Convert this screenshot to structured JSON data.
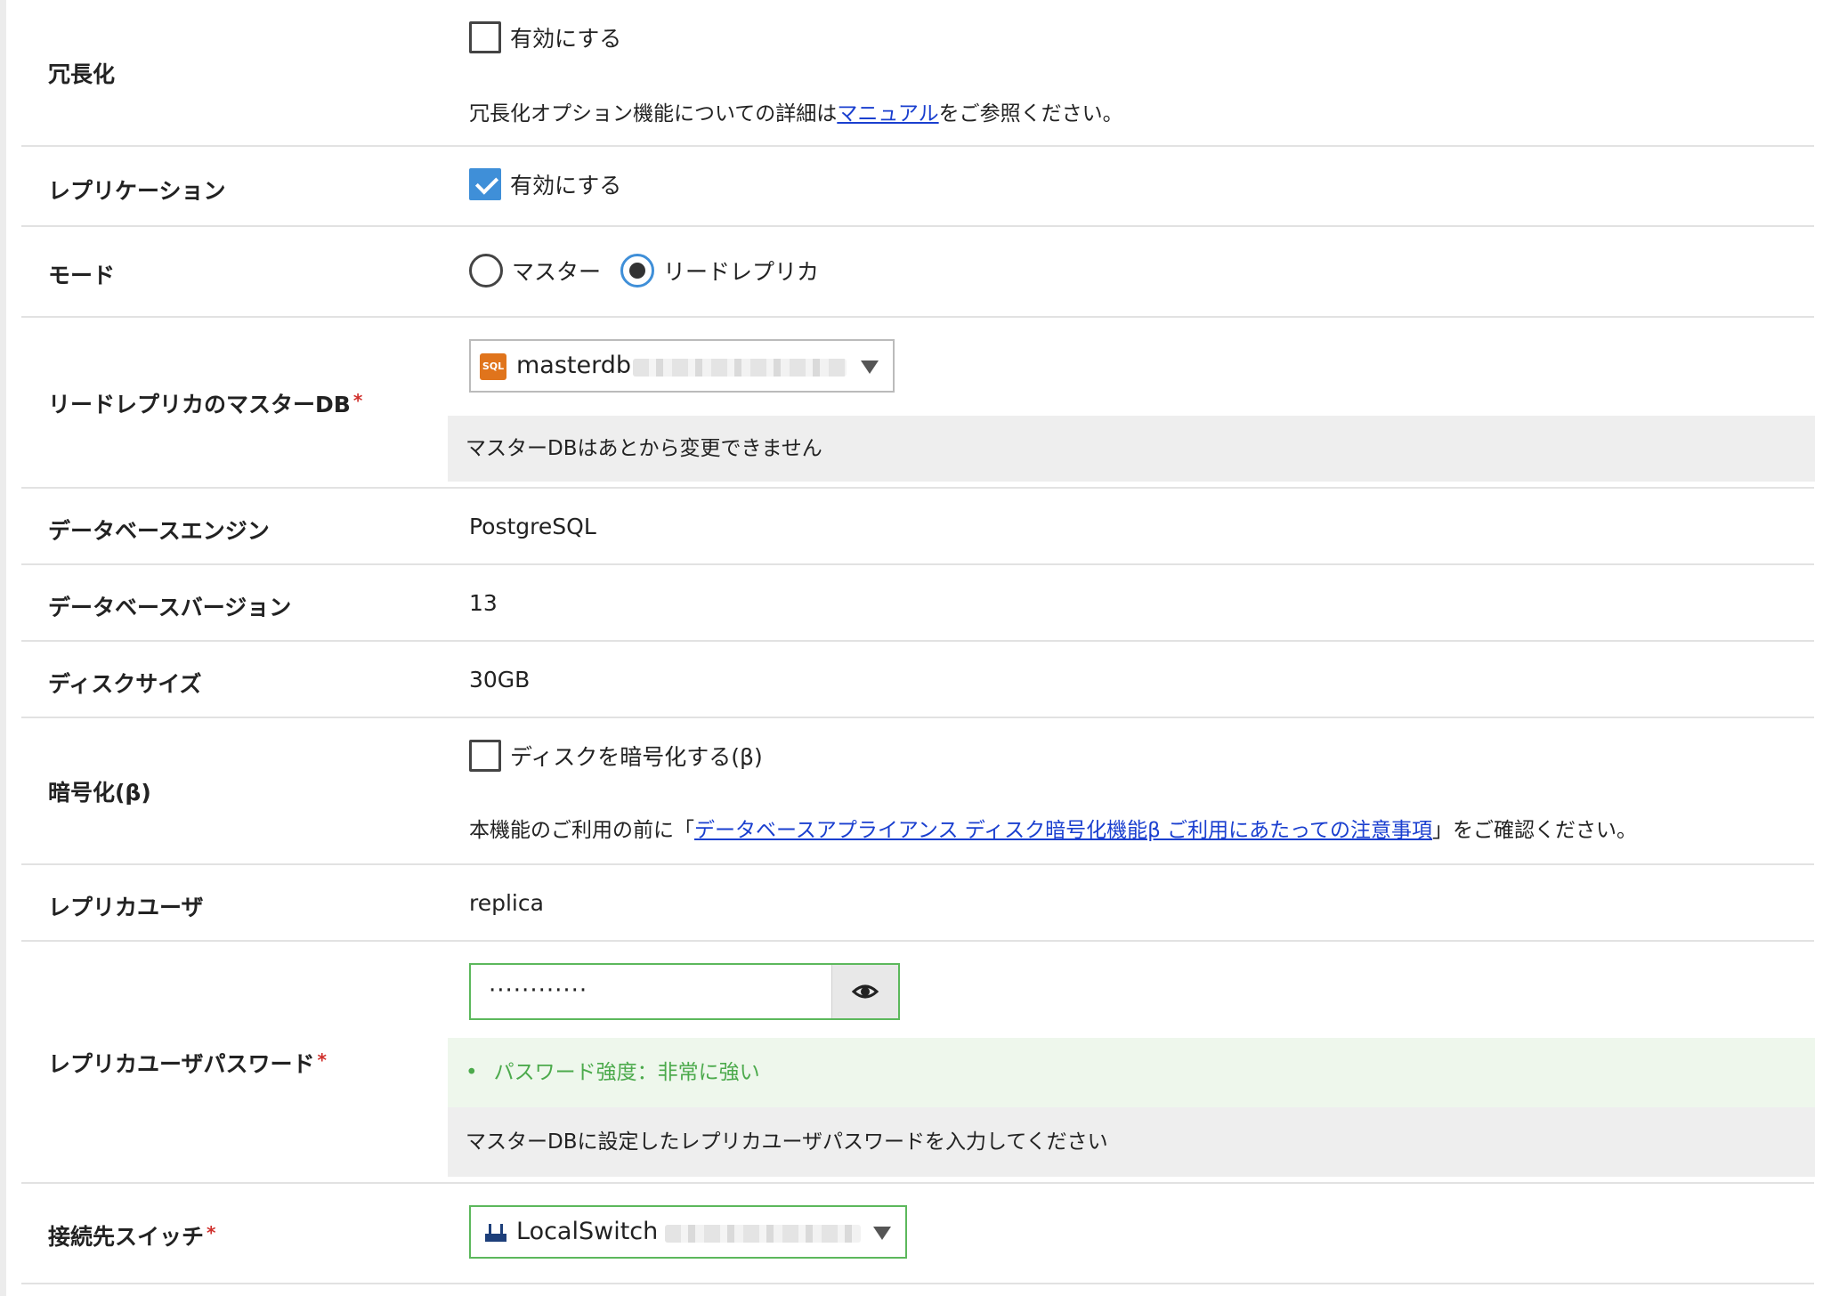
{
  "form": {
    "redundancy": {
      "label": "冗長化",
      "checkbox_label": "有効にする",
      "checked": false,
      "note_prefix": "冗長化オプション機能についての詳細は",
      "note_link": "マニュアル",
      "note_suffix": "をご参照ください。"
    },
    "replication": {
      "label": "レプリケーション",
      "checkbox_label": "有効にする",
      "checked": true
    },
    "mode": {
      "label": "モード",
      "options": [
        "マスター",
        "リードレプリカ"
      ],
      "selected": "リードレプリカ"
    },
    "master_db": {
      "label": "リードレプリカのマスターDB",
      "required_mark": "*",
      "icon_text": "SQL",
      "selected": "masterdb",
      "help": "マスターDBはあとから変更できません"
    },
    "engine": {
      "label": "データベースエンジン",
      "value": "PostgreSQL"
    },
    "version": {
      "label": "データベースバージョン",
      "value": "13"
    },
    "disk_size": {
      "label": "ディスクサイズ",
      "value": "30GB"
    },
    "encryption": {
      "label": "暗号化(β)",
      "checkbox_label": "ディスクを暗号化する(β)",
      "checked": false,
      "note_prefix": "本機能のご利用の前に「",
      "note_link": "データベースアプライアンス ディスク暗号化機能β ご利用にあたっての注意事項",
      "note_suffix": "」をご確認ください。"
    },
    "replica_user": {
      "label": "レプリカユーザ",
      "value": "replica"
    },
    "replica_password": {
      "label": "レプリカユーザパスワード",
      "required_mark": "*",
      "masked_value": "············",
      "strength_bullet": "•",
      "strength": "パスワード強度：非常に強い",
      "help": "マスターDBに設定したレプリカユーザパスワードを入力してください"
    },
    "switch": {
      "label": "接続先スイッチ",
      "required_mark": "*",
      "selected": "LocalSwitch"
    }
  },
  "colors": {
    "accent": "#3f8fd8",
    "link": "#1a3fcf",
    "required": "#d0312d",
    "success": "#4caa4c",
    "valid_border": "#5cb85c"
  },
  "icons": [
    "checkbox",
    "radio",
    "sql-db-icon",
    "dropdown-arrow-icon",
    "eye-icon",
    "switch-icon"
  ]
}
